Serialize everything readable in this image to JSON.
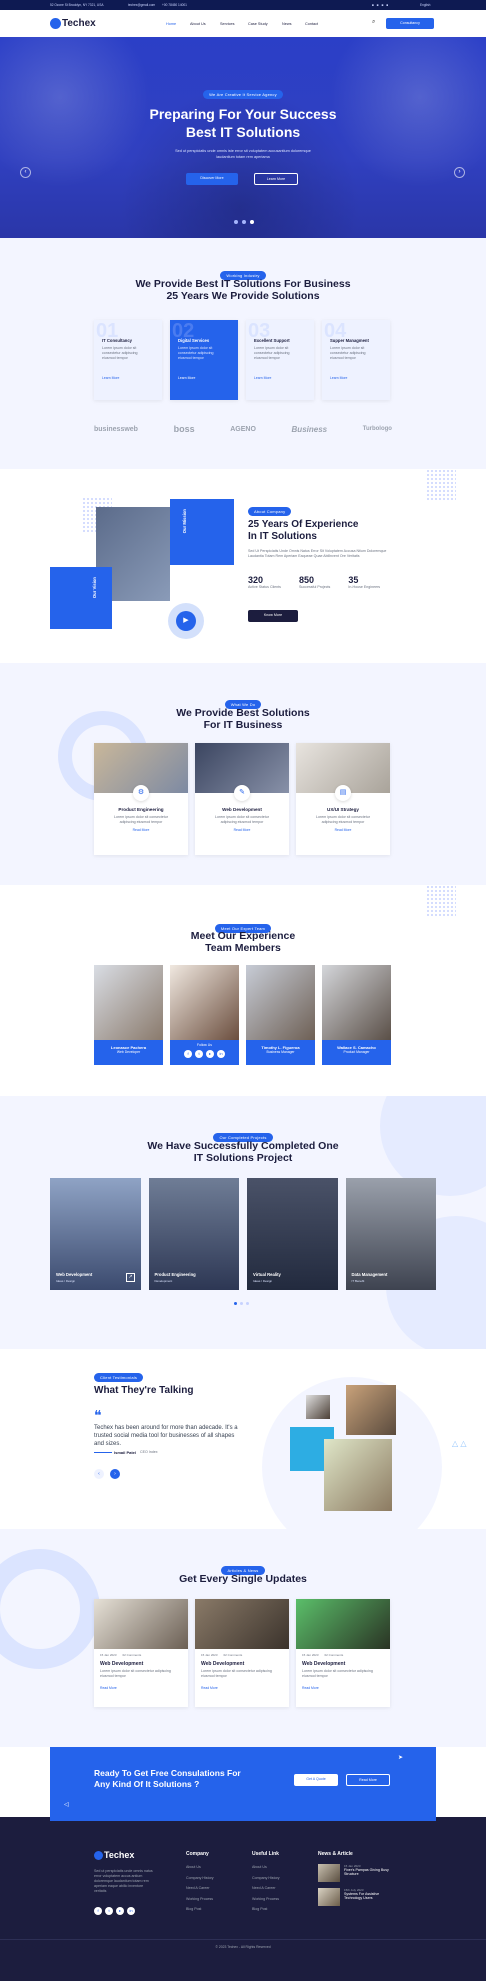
{
  "topbar": {
    "address": "52 Ozone St Brooklyn, NY 7321, USA",
    "email": "techex@gmail.com",
    "phone": "+00 78450 14001",
    "language": "English"
  },
  "header": {
    "logo": "Techex",
    "nav": [
      "Home",
      "About Us",
      "Services",
      "Case Study",
      "News",
      "Contact"
    ],
    "cta": "Consultancy"
  },
  "hero": {
    "badge": "We Are Creative It Service Agency",
    "title_line1": "Preparing For Your Success",
    "title_line2": "Best IT Solutions",
    "desc_line1": "Sed ut perspiciatis unde omnis iste error sit voluptatem accusantium doloremque",
    "desc_line2": "laudantium totam rem aperiama",
    "btn_primary": "Discover More",
    "btn_secondary": "Learn More"
  },
  "features": {
    "badge": "Working Industry",
    "title_line1": "We Provide Best IT Solutions For Business",
    "title_line2": "25 Years We Provide Solutions",
    "cards": [
      {
        "num": "01",
        "title": "IT Consultancy",
        "desc": "Lorem ipsum dolor sit consectetur adipiscing eiusmod tempor",
        "link": "Learn More"
      },
      {
        "num": "02",
        "title": "Digital Services",
        "desc": "Lorem ipsum dolor sit consectetur adipiscing eiusmod tempor",
        "link": "Learn More"
      },
      {
        "num": "03",
        "title": "Excellent Support",
        "desc": "Lorem ipsum dolor sit consectetur adipiscing eiusmod tempor",
        "link": "Learn More"
      },
      {
        "num": "04",
        "title": "Supper Managment",
        "desc": "Lorem ipsum dolor sit consectetur adipiscing eiusmod tempor",
        "link": "Learn More"
      }
    ]
  },
  "brands": [
    "businessweb",
    "boss",
    "AGENO",
    "Business",
    "Turbologo"
  ],
  "about": {
    "badge": "About Company",
    "title_line1": "25 Years Of Experience",
    "title_line2": "In IT Solutions",
    "desc": "Sed Ut Perspiciatis Unde Omnis Natus Error Sit Voluptatem Accusa Ntium Doloremque Laudantia Totam Rem Aperiam Eaqueae Quae Abillnvent Ore Veritatis",
    "tag_mission": "Our Mission",
    "tag_vision": "Our Vision",
    "stats": [
      {
        "value": "320",
        "label": "Active Status Clients"
      },
      {
        "value": "850",
        "label": "Successful Projects"
      },
      {
        "value": "35",
        "label": "In-House Engineers"
      }
    ],
    "btn": "Know More"
  },
  "solutions": {
    "badge": "What We Do",
    "title_line1": "We Provide Best Solutions",
    "title_line2": "For IT Business",
    "cards": [
      {
        "title": "Product Engineering",
        "desc": "Lorem ipsum dolor sit consectetur adipiscing eiusmod tempor",
        "link": "Read More"
      },
      {
        "title": "Web Development",
        "desc": "Lorem ipsum dolor sit consectetur adipiscing eiusmod tempor",
        "link": "Read More"
      },
      {
        "title": "UX/UI Strategy",
        "desc": "Lorem ipsum dolor sit consectetur adipiscing eiusmod tempor",
        "link": "Read More"
      }
    ]
  },
  "team": {
    "badge": "Meet Our Expert Team",
    "title_line1": "Meet Our Experience",
    "title_line2": "Team Members",
    "members": [
      {
        "name": "Leonasce Pachera",
        "role": "Web Developer"
      },
      {
        "name": "Follow Us",
        "role": ""
      },
      {
        "name": "Timothy L. Figueroa",
        "role": "Business Manager"
      },
      {
        "name": "Wallace S. Camacho",
        "role": "Product Manager"
      }
    ]
  },
  "projects": {
    "badge": "Our Completed Projects",
    "title_line1": "We Have Successfully Completed One",
    "title_line2": "IT Solutions Project",
    "items": [
      {
        "title": "Web Development",
        "sub": "Ideas / Design"
      },
      {
        "title": "Product Engineering",
        "sub": "Development"
      },
      {
        "title": "Virtual Reality",
        "sub": "Ideas / Design"
      },
      {
        "title": "Data Management",
        "sub": "IT Benefit"
      }
    ]
  },
  "testimonial": {
    "badge": "Client Testimonials",
    "title": "What They're Talking",
    "quote_line1": "Techex has been around for more than adecade. It's a",
    "quote_line2": "trusted social media tool for businesses of all shapes",
    "quote_line3": "and sizes.",
    "author": "Ismail Patel",
    "author_role": "CEO Index"
  },
  "news": {
    "badge": "Articles & News",
    "title": "Get Every Single Updates",
    "posts": [
      {
        "date": "15 Jan 2023",
        "comments": "02 Comments",
        "title": "Web Development",
        "desc": "Lorem ipsum dolor sit consectetur adipiscing eiusmod tempor",
        "link": "Read More"
      },
      {
        "date": "15 Jan 2023",
        "comments": "02 Comments",
        "title": "Web Development",
        "desc": "Lorem ipsum dolor sit consectetur adipiscing eiusmod tempor",
        "link": "Read More"
      },
      {
        "date": "15 Jan 2023",
        "comments": "02 Comments",
        "title": "Web Development",
        "desc": "Lorem ipsum dolor sit consectetur adipiscing eiusmod tempor",
        "link": "Read More"
      }
    ]
  },
  "cta": {
    "title_line1": "Ready To Get Free Consulations For",
    "title_line2": "Any Kind Of It Solutions ?",
    "btn_primary": "Get A Quote",
    "btn_secondary": "Read More"
  },
  "footer": {
    "logo": "Techex",
    "about": "Sed ut perspiciatis unde omnis natus error voluptatem accus antium doloremque laudantium totam rem aperiam eaque abillo inventore veritatis",
    "company_title": "Company",
    "company_links": [
      "About Us",
      "Company History",
      "Need A Career",
      "Working Process",
      "Blog Post"
    ],
    "useful_title": "Useful Link",
    "useful_links": [
      "About Us",
      "Company History",
      "Need A Career",
      "Working Process",
      "Blog Post"
    ],
    "news_title": "News & Article",
    "news_items": [
      {
        "date": "15 Jan 2023",
        "title": "Fixer's Pampas Giving Busy Structure"
      },
      {
        "date": "15th July 2023",
        "title": "Systems For Assistive Technology Users"
      }
    ],
    "copyright": "© 2023 Techex - All Rights Reserved"
  },
  "colors": {
    "primary": "#2563eb",
    "dark": "#1c1d3e"
  }
}
